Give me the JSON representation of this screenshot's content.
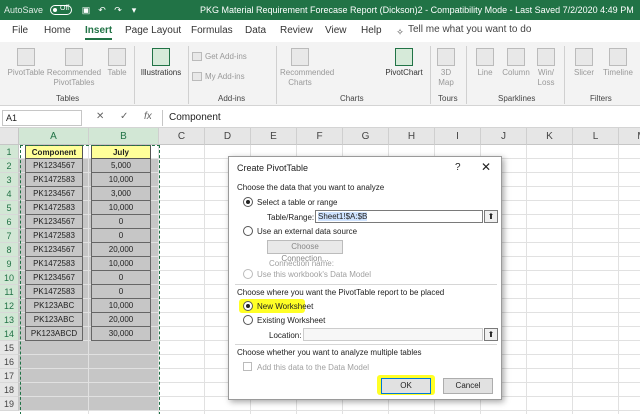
{
  "titlebar": {
    "autosave_label": "AutoSave",
    "autosave_state": "Off",
    "title": "PKG Material Requirement Forecase Report (Dickson)2  -  Compatibility Mode  -  Last Saved 7/2/2020 4:49 PM"
  },
  "tabs": [
    "File",
    "Home",
    "Insert",
    "Page Layout",
    "Formulas",
    "Data",
    "Review",
    "View",
    "Help"
  ],
  "active_tab": "Insert",
  "tell_me": "Tell me what you want to do",
  "ribbon": {
    "pivottable": "PivotTable",
    "recommended_pivottables": "Recommended PivotTables",
    "table": "Table",
    "illustrations": "Illustrations",
    "get_addins": "Get Add-ins",
    "my_addins": "My Add-ins",
    "recommended_charts": "Recommended Charts",
    "pivotchart": "PivotChart",
    "map_3d": "3D Map",
    "line": "Line",
    "column": "Column",
    "win_loss": "Win/ Loss",
    "slicer": "Slicer",
    "timeline": "Timeline",
    "groups": {
      "tables": "Tables",
      "addins": "Add-ins",
      "charts": "Charts",
      "tours": "Tours",
      "sparklines": "Sparklines",
      "filters": "Filters"
    }
  },
  "formula_bar": {
    "name_box": "A1",
    "fx": "fx",
    "content": "Component"
  },
  "columns": [
    "A",
    "B",
    "C",
    "D",
    "E",
    "F",
    "G",
    "H",
    "I",
    "J",
    "K",
    "L",
    "M"
  ],
  "rows": [
    "1",
    "2",
    "3",
    "4",
    "5",
    "6",
    "7",
    "8",
    "9",
    "10",
    "11",
    "12",
    "13",
    "14",
    "15",
    "16",
    "17",
    "18",
    "19"
  ],
  "sheet": {
    "header": [
      "Component",
      "July"
    ],
    "data": [
      [
        "PK1234567",
        "5,000"
      ],
      [
        "PK1472583",
        "10,000"
      ],
      [
        "PK1234567",
        "3,000"
      ],
      [
        "PK1472583",
        "10,000"
      ],
      [
        "PK1234567",
        "0"
      ],
      [
        "PK1472583",
        "0"
      ],
      [
        "PK1234567",
        "20,000"
      ],
      [
        "PK1472583",
        "10,000"
      ],
      [
        "PK1234567",
        "0"
      ],
      [
        "PK1472583",
        "0"
      ],
      [
        "PK123ABC",
        "10,000"
      ],
      [
        "PK123ABC",
        "20,000"
      ],
      [
        "PK123ABCD",
        "30,000"
      ]
    ]
  },
  "dialog": {
    "title": "Create PivotTable",
    "help": "?",
    "close": "✕",
    "section1": "Choose the data that you want to analyze",
    "opt_select_table": "Select a table or range",
    "table_range_label": "Table/Range:",
    "table_range_value": "Sheet1!$A:$B",
    "opt_external": "Use an external data source",
    "choose_connection": "Choose Connection...",
    "connection_name": "Connection name:",
    "opt_data_model": "Use this workbook's Data Model",
    "section2": "Choose where you want the PivotTable report to be placed",
    "opt_new_ws": "New Worksheet",
    "opt_existing_ws": "Existing Worksheet",
    "location_label": "Location:",
    "location_value": "",
    "section3": "Choose whether you want to analyze multiple tables",
    "add_data_model": "Add this data to the Data Model",
    "ok": "OK",
    "cancel": "Cancel"
  },
  "colors": {
    "excel_green": "#217346",
    "header_fill": "#ffff99",
    "range_fill": "#c6c6c6",
    "highlight": "#ffff00"
  }
}
